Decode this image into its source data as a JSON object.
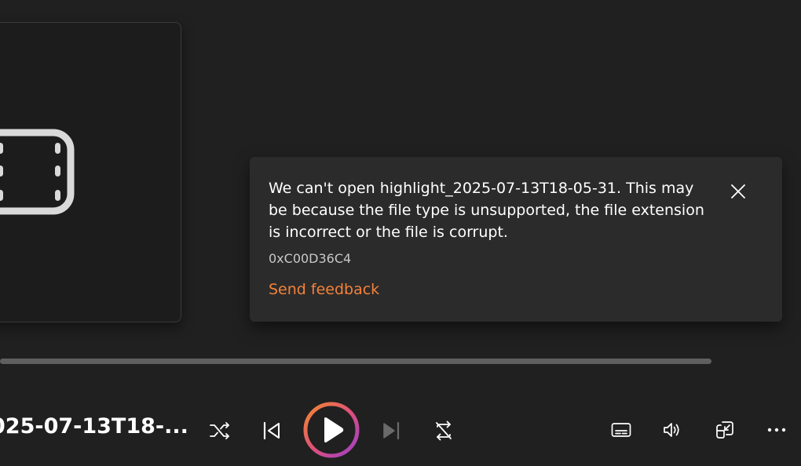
{
  "error_toast": {
    "message": "We can't open highlight_2025-07-13T18-05-31. This may be because the file type is unsupported, the file extension is incorrect or the file is corrupt.",
    "error_code": "0xC00D36C4",
    "feedback_link": "Send feedback",
    "close_icon": "close-icon"
  },
  "player": {
    "track_title": "025-07-13T18-...",
    "controls": {
      "shuffle_icon": "shuffle-icon",
      "previous_icon": "previous-icon",
      "play_icon": "play-icon",
      "next_icon": "next-icon",
      "repeat_icon": "repeat-icon",
      "captions_icon": "captions-icon",
      "volume_icon": "volume-icon",
      "mini_player_icon": "mini-player-icon",
      "more_icon": "more-icon"
    },
    "seek_progress": 0
  },
  "thumbnail": {
    "placeholder_icon": "film-icon"
  },
  "colors": {
    "accent_link": "#f4823a",
    "play_ring_start": "#f28a2e",
    "play_ring_end": "#9b3fc9",
    "background": "#202020",
    "toast_background": "#2b2b2b"
  }
}
